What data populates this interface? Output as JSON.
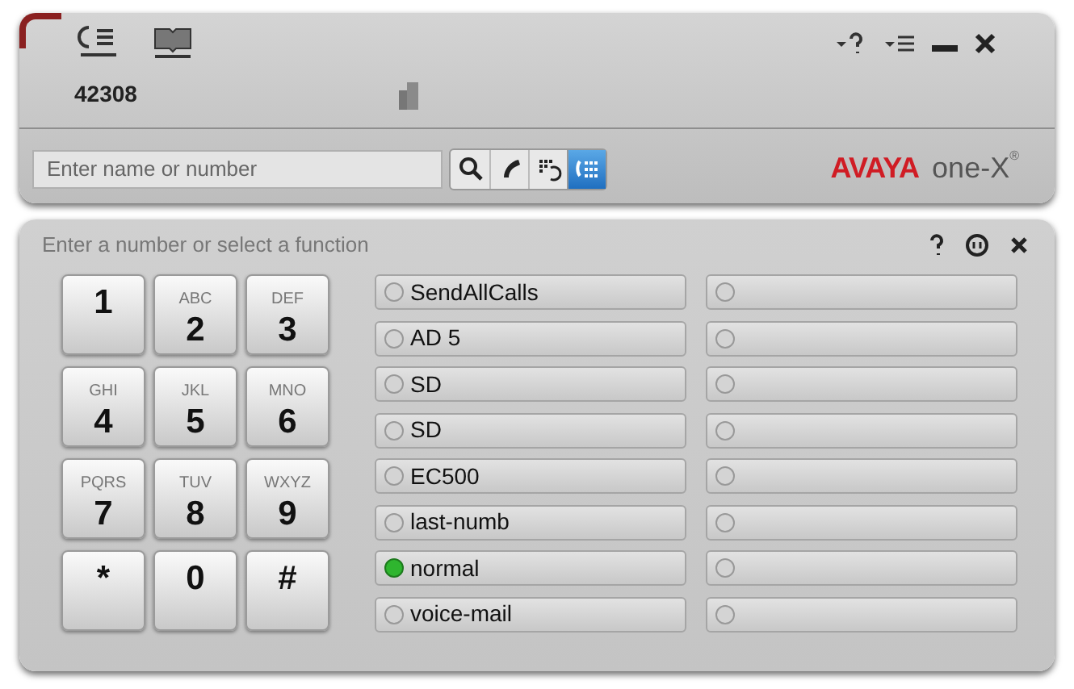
{
  "top_bar": {
    "extension": "42308"
  },
  "search": {
    "placeholder": "Enter name or number"
  },
  "view_buttons": [
    {
      "kind": "search",
      "selected": false
    },
    {
      "kind": "phone",
      "selected": false
    },
    {
      "kind": "history",
      "selected": false
    },
    {
      "kind": "keypad",
      "selected": true
    }
  ],
  "logo": {
    "brand": "AVAYA",
    "product": "one-X",
    "mark": "®"
  },
  "dialpad": {
    "prompt": "Enter a number or select a function",
    "keys": [
      {
        "digit": "1"
      },
      {
        "digit": "2",
        "letters": "ABC"
      },
      {
        "digit": "3",
        "letters": "DEF"
      },
      {
        "digit": "4",
        "letters": "GHI"
      },
      {
        "digit": "5",
        "letters": "JKL"
      },
      {
        "digit": "6",
        "letters": "MNO"
      },
      {
        "digit": "7",
        "letters": "PQRS"
      },
      {
        "digit": "8",
        "letters": "TUV"
      },
      {
        "digit": "9",
        "letters": "WXYZ"
      },
      {
        "digit": "*"
      },
      {
        "digit": "0"
      },
      {
        "digit": "#"
      }
    ]
  },
  "feature_buttons": [
    {
      "label": "SendAllCalls",
      "lamp_on": false
    },
    {
      "label": "AD 5",
      "lamp_on": false
    },
    {
      "label": "SD",
      "lamp_on": false
    },
    {
      "label": "SD",
      "lamp_on": false
    },
    {
      "label": "EC500",
      "lamp_on": false
    },
    {
      "label": "last-numb",
      "lamp_on": false
    },
    {
      "label": "normal",
      "lamp_on": true
    },
    {
      "label": "voice-mail",
      "lamp_on": false
    }
  ],
  "empty_feature_buttons": [
    {
      "lamp_on": false
    },
    {
      "lamp_on": false
    },
    {
      "lamp_on": false
    },
    {
      "lamp_on": false
    },
    {
      "lamp_on": false
    },
    {
      "lamp_on": false
    },
    {
      "lamp_on": false
    },
    {
      "lamp_on": false
    }
  ]
}
